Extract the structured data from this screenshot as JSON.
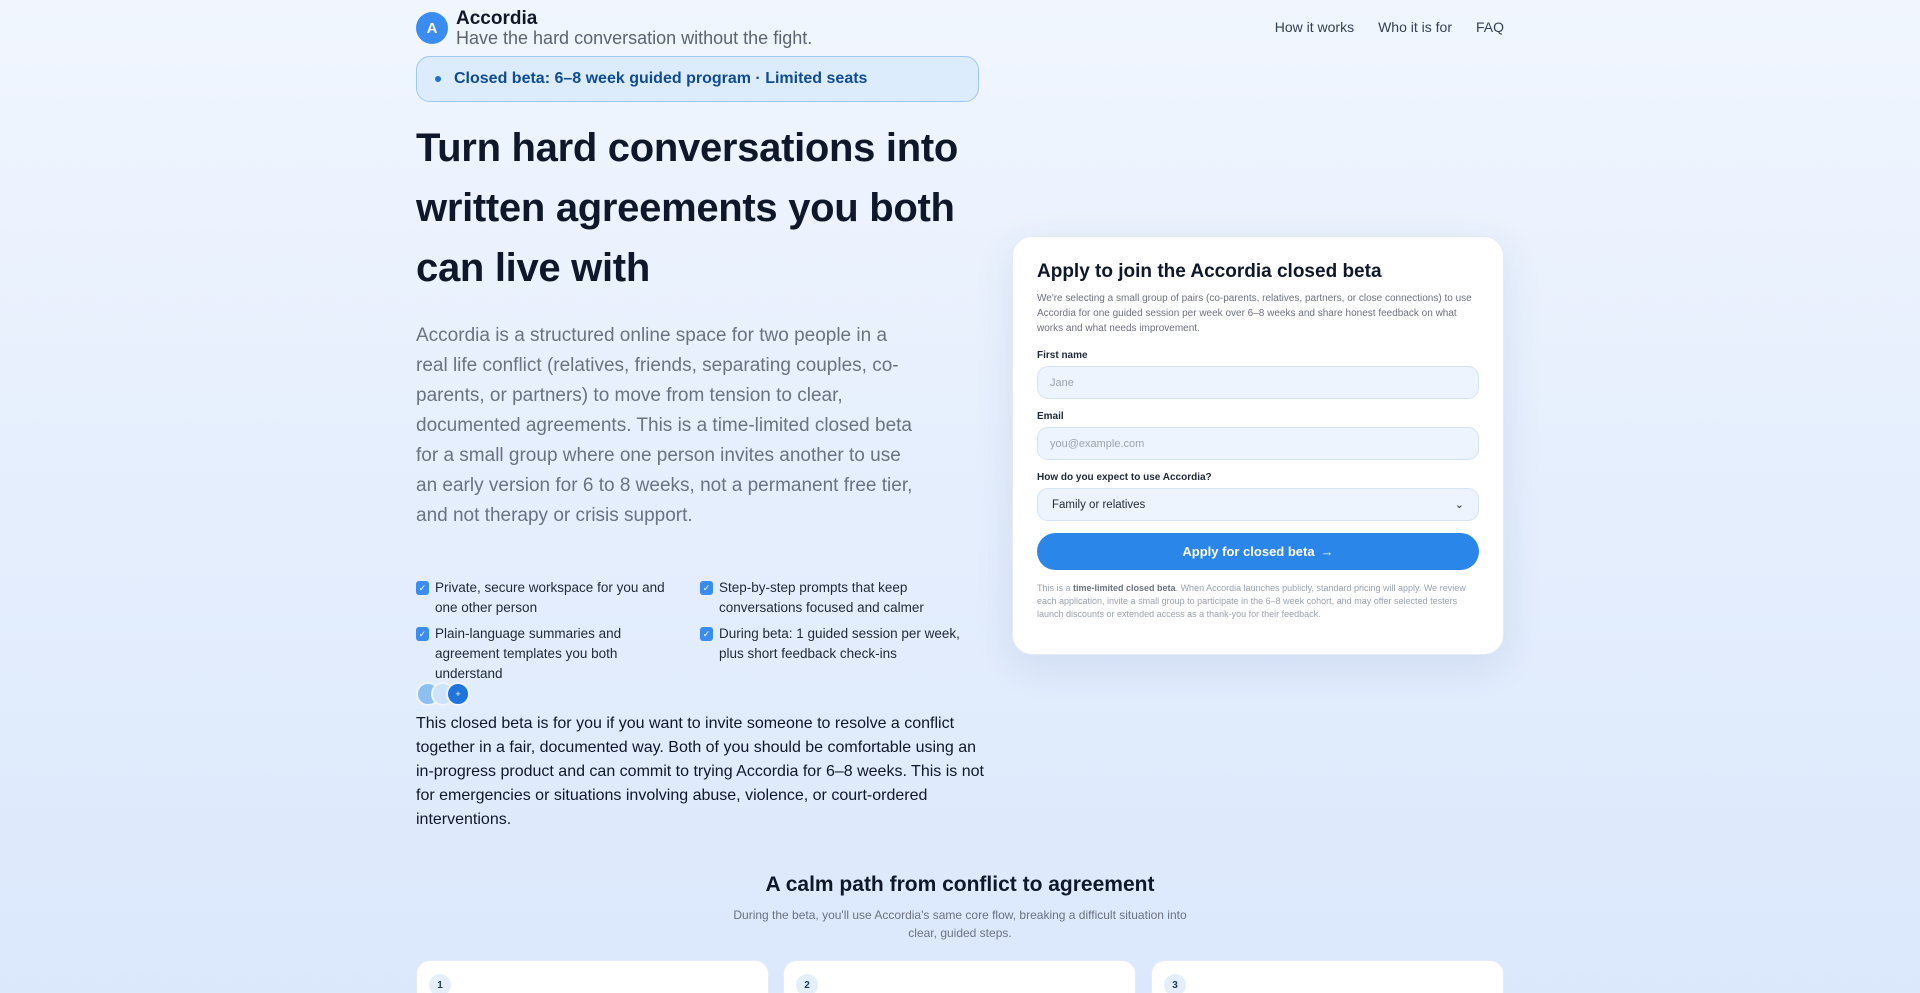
{
  "brand": {
    "logo_letter": "A",
    "name": "Accordia",
    "tagline": "Have the hard conversation without the fight."
  },
  "nav": {
    "items": [
      "How it works",
      "Who it is for",
      "FAQ"
    ]
  },
  "beta_pill": {
    "text": "Closed beta: 6–8 week guided program · Limited seats"
  },
  "hero": {
    "title": "Turn hard conversations into written agreements you both can live with",
    "description": "Accordia is a structured online space for two people in a real life conflict (relatives, friends, separating couples, co-parents, or partners) to move from tension to clear, documented agreements. This is a time-limited closed beta for a small group where one person invites another to use an early version for 6 to 8 weeks, not a permanent free tier, and not therapy or crisis support.",
    "features": [
      "Private, secure workspace for you and one other person",
      "Step-by-step prompts that keep conversations focused and calmer",
      "Plain-language summaries and agreement templates you both understand",
      "During beta: 1 guided session per week, plus short feedback check-ins"
    ],
    "avatar_more": "+",
    "beta_note": "This closed beta is for you if you want to invite someone to resolve a conflict together in a fair, documented way. Both of you should be comfortable using an in-progress product and can commit to trying Accordia for 6–8 weeks. This is not for emergencies or situations involving abuse, violence, or court-ordered interventions."
  },
  "form": {
    "title": "Apply to join the Accordia closed beta",
    "description": "We're selecting a small group of pairs (co-parents, relatives, partners, or close connections) to use Accordia for one guided session per week over 6–8 weeks and share honest feedback on what works and what needs improvement.",
    "first_name_label": "First name",
    "first_name_placeholder": "Jane",
    "email_label": "Email",
    "email_placeholder": "you@example.com",
    "use_label": "How do you expect to use Accordia?",
    "use_selected": "Family or relatives",
    "submit_label": "Apply for closed beta",
    "submit_arrow": "→",
    "fine_print_prefix": "This is a",
    "fine_print_bold": "time-limited closed beta",
    "fine_print_rest": ". When Accordia launches publicly, standard pricing will apply. We review each application, invite a small group to participate in the 6–8 week cohort, and may offer selected testers launch discounts or extended access as a thank-you for their feedback."
  },
  "how_it_works": {
    "title": "A calm path from conflict to agreement",
    "subtitle": "During the beta, you'll use Accordia's same core flow, breaking a difficult situation into clear, guided steps.",
    "steps": [
      "1",
      "2",
      "3"
    ]
  },
  "colors": {
    "accent": "#2b86ea",
    "pill_bg": "#dcecfd",
    "pill_border": "#9cc8f3",
    "text_dark": "#0f172a",
    "text_muted": "#6b7280"
  }
}
